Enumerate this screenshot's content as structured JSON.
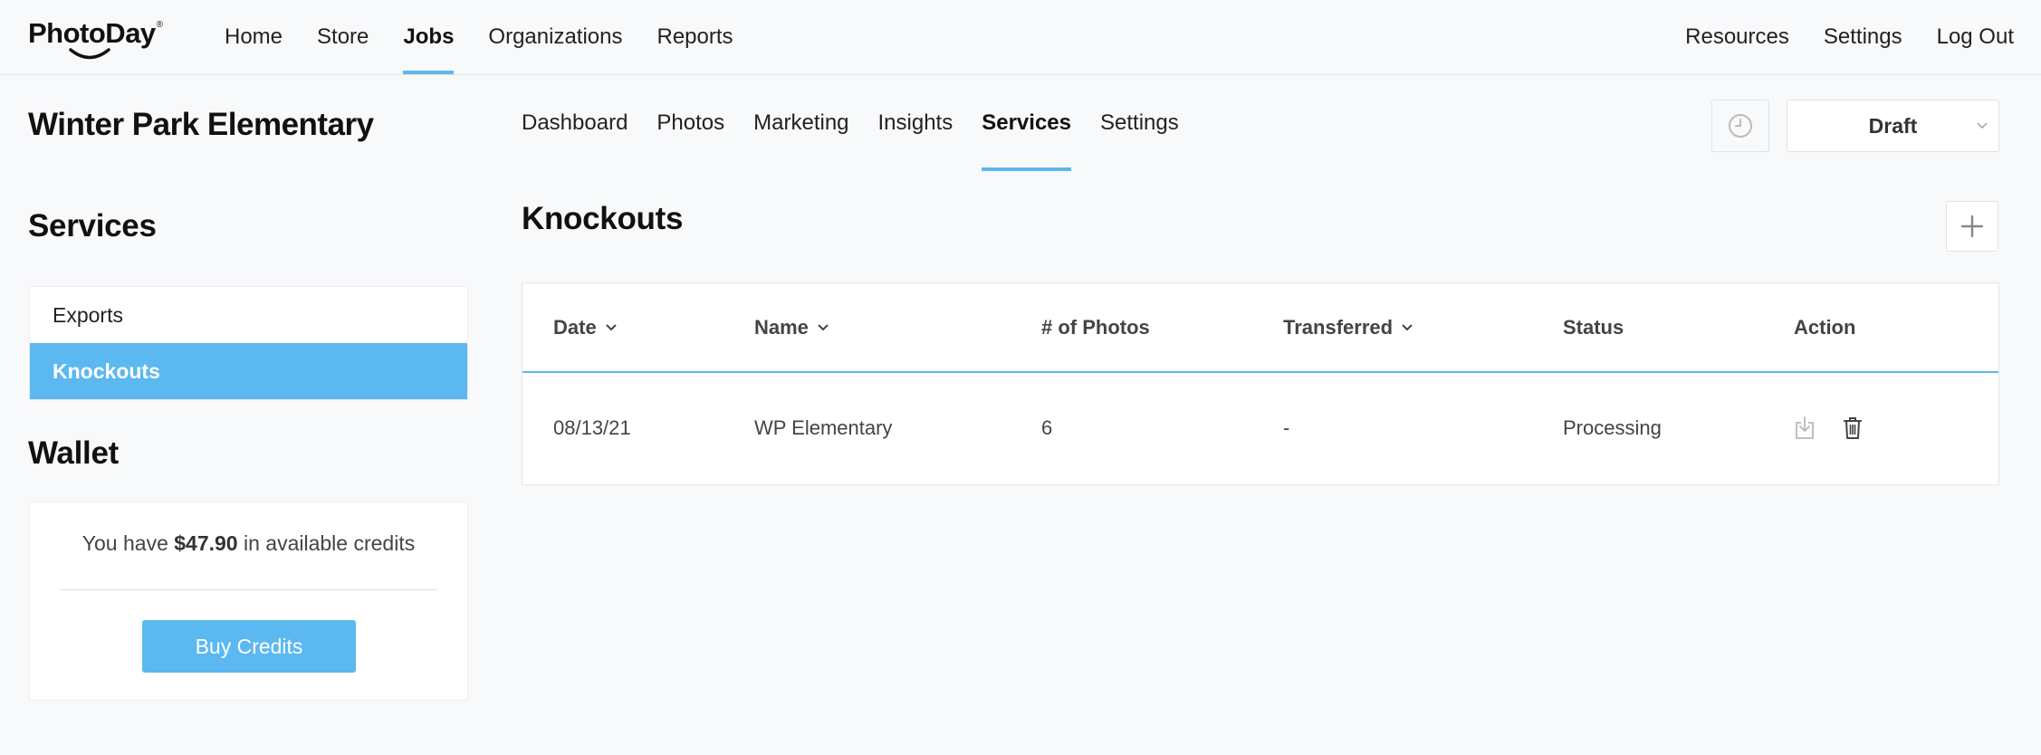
{
  "brand": {
    "logo_text": "PhotoDay",
    "logo_mark": "®"
  },
  "topnav": {
    "left": [
      {
        "label": "Home",
        "active": false
      },
      {
        "label": "Store",
        "active": false
      },
      {
        "label": "Jobs",
        "active": true
      },
      {
        "label": "Organizations",
        "active": false
      },
      {
        "label": "Reports",
        "active": false
      }
    ],
    "right": [
      {
        "label": "Resources"
      },
      {
        "label": "Settings"
      },
      {
        "label": "Log Out"
      }
    ]
  },
  "job": {
    "title": "Winter Park Elementary"
  },
  "subnav": [
    {
      "label": "Dashboard",
      "active": false
    },
    {
      "label": "Photos",
      "active": false
    },
    {
      "label": "Marketing",
      "active": false
    },
    {
      "label": "Insights",
      "active": false
    },
    {
      "label": "Services",
      "active": true
    },
    {
      "label": "Settings",
      "active": false
    }
  ],
  "job_status": {
    "value": "Draft"
  },
  "sidebar": {
    "title": "Services",
    "items": [
      {
        "label": "Exports",
        "active": false
      },
      {
        "label": "Knockouts",
        "active": true
      }
    ]
  },
  "wallet": {
    "title": "Wallet",
    "prefix": "You have ",
    "amount": "$47.90",
    "suffix": " in available credits",
    "button_label": "Buy Credits"
  },
  "content": {
    "title": "Knockouts",
    "table": {
      "headers": {
        "date": "Date",
        "name": "Name",
        "photos": "# of Photos",
        "transferred": "Transferred",
        "status": "Status",
        "action": "Action"
      },
      "rows": [
        {
          "date": "08/13/21",
          "name": "WP Elementary",
          "photos": "6",
          "transferred": "-",
          "status": "Processing"
        }
      ]
    }
  },
  "icons": {
    "history": "clock-icon",
    "dropdown": "chevron-down-icon",
    "add": "plus-icon",
    "download": "download-icon",
    "delete": "trash-icon"
  },
  "colors": {
    "accent": "#5bb8f0",
    "background": "#f8f9fb",
    "text": "#222222",
    "muted_text": "#444444"
  }
}
